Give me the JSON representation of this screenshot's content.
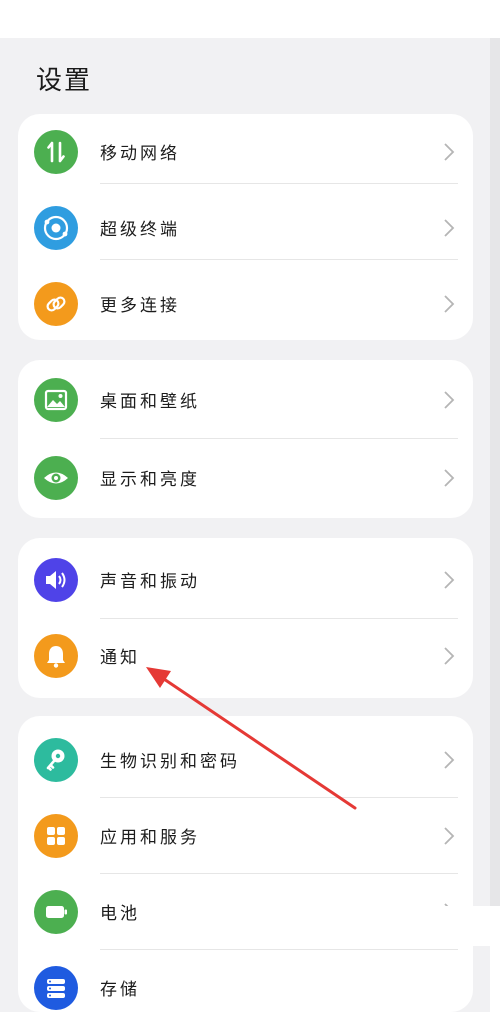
{
  "page_title": "设置",
  "colors": {
    "mobile_network": "#4caf50",
    "super_device": "#2f9de0",
    "more_connections": "#f39a1c",
    "wallpaper": "#4caf50",
    "display": "#4caf50",
    "sound": "#4f43e8",
    "notifications": "#f39a1c",
    "biometrics": "#2dbb9e",
    "apps": "#f39a1c",
    "battery": "#4caf50",
    "storage": "#1f5be0",
    "arrow": "#e53935"
  },
  "groups": [
    {
      "items": [
        {
          "label": "移动网络",
          "icon": "mobile-network-icon"
        },
        {
          "label": "超级终端",
          "icon": "super-device-icon"
        },
        {
          "label": "更多连接",
          "icon": "link-icon"
        }
      ]
    },
    {
      "items": [
        {
          "label": "桌面和壁纸",
          "icon": "wallpaper-icon"
        },
        {
          "label": "显示和亮度",
          "icon": "eye-icon"
        }
      ]
    },
    {
      "items": [
        {
          "label": "声音和振动",
          "icon": "speaker-icon"
        },
        {
          "label": "通知",
          "icon": "bell-icon"
        }
      ]
    },
    {
      "items": [
        {
          "label": "生物识别和密码",
          "icon": "key-icon"
        },
        {
          "label": "应用和服务",
          "icon": "apps-grid-icon"
        },
        {
          "label": "电池",
          "icon": "battery-icon"
        },
        {
          "label": "存储",
          "icon": "storage-icon"
        }
      ]
    }
  ]
}
